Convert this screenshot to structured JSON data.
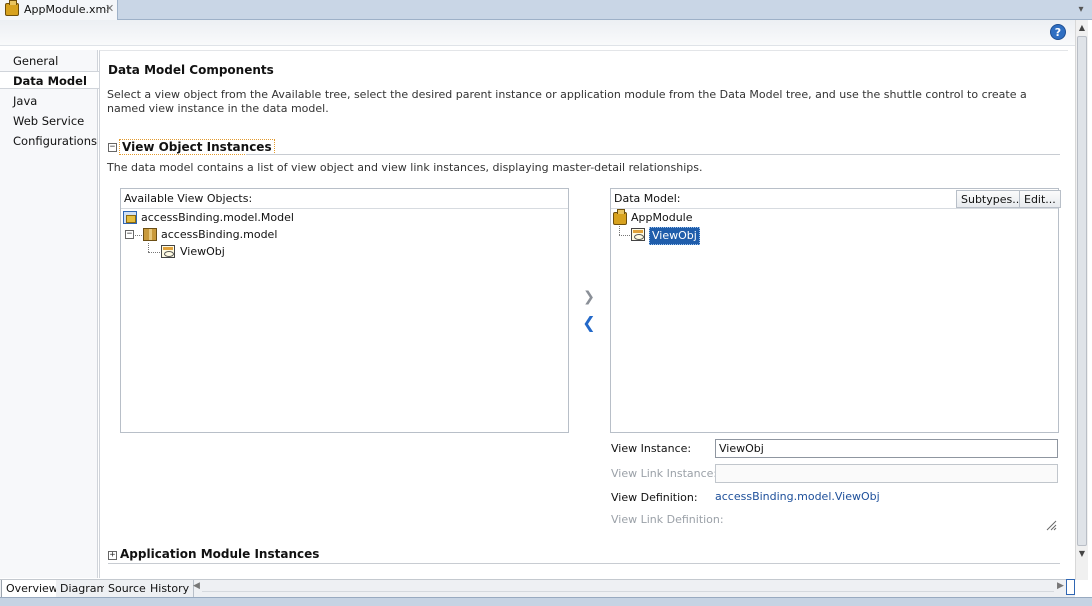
{
  "editor_tab": {
    "title": "AppModule.xml",
    "close": "✕"
  },
  "help": {
    "label": "?"
  },
  "nav": {
    "items": [
      {
        "label": "General"
      },
      {
        "label": "Data Model"
      },
      {
        "label": "Java"
      },
      {
        "label": "Web Service"
      },
      {
        "label": "Configurations"
      }
    ],
    "selected": "Data Model"
  },
  "section": {
    "title": "Data Model Components",
    "description": "Select a view object from the Available tree, select the desired parent instance or application module from the Data Model tree, and use the shuttle control to create a named view instance in the data model."
  },
  "voi": {
    "toggle": "−",
    "title": "View Object Instances",
    "description": "The data model contains a list of view object and view link instances, displaying master-detail relationships."
  },
  "available": {
    "header": "Available View Objects:",
    "nodes": [
      {
        "label": "accessBinding.model.Model",
        "icon": "package-folder-icon"
      },
      {
        "label": "accessBinding.model",
        "icon": "package-icon",
        "expander": "−"
      },
      {
        "label": "ViewObj",
        "icon": "view-object-icon"
      }
    ]
  },
  "data_model": {
    "header": "Data Model:",
    "subtypes_button": "Subtypes...",
    "edit_button": "Edit...",
    "nodes": [
      {
        "label": "AppModule",
        "icon": "app-module-icon"
      },
      {
        "label": "ViewObj",
        "icon": "view-object-instance-icon",
        "selected": true
      }
    ]
  },
  "shuttle": {
    "add": "❯",
    "remove": "❮"
  },
  "properties": {
    "view_instance_label": "View Instance:",
    "view_instance_value": "ViewObj",
    "view_link_instance_label": "View Link Instance:",
    "view_link_instance_value": "",
    "view_definition_label": "View Definition:",
    "view_definition_value": "accessBinding.model.ViewObj",
    "view_link_definition_label": "View Link Definition:"
  },
  "ami": {
    "toggle": "+",
    "title": "Application Module Instances"
  },
  "bottom_tabs": [
    {
      "label": "Overview",
      "selected": true
    },
    {
      "label": "Diagram"
    },
    {
      "label": "Source"
    },
    {
      "label": "History"
    }
  ],
  "colors": {
    "selection": "#1f5dab",
    "link": "#1d4f9a",
    "tabstrip": "#c9d6e6",
    "help": "#2f6fc2"
  }
}
